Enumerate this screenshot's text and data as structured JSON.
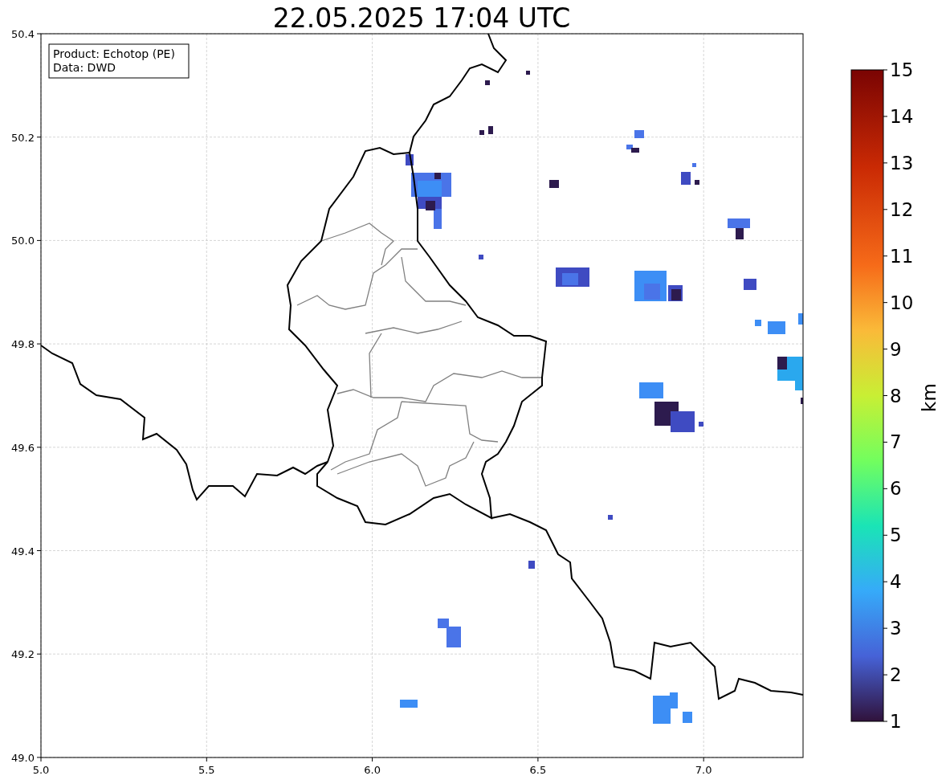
{
  "title": "22.05.2025 17:04 UTC",
  "info_box": [
    "Product: Echotop (PE)",
    "Data: DWD"
  ],
  "x_axis": {
    "ticks": [
      "5.0",
      "5.5",
      "6.0",
      "6.5",
      "7.0"
    ]
  },
  "y_axis": {
    "ticks": [
      "50.4",
      "50.2",
      "50.0",
      "49.8",
      "49.6",
      "49.4",
      "49.2",
      "49.0"
    ]
  },
  "colorbar": {
    "ticks": [
      "15",
      "14",
      "13",
      "12",
      "11",
      "10",
      "9",
      "8",
      "7",
      "6",
      "5",
      "4",
      "3",
      "2",
      "1"
    ],
    "label": "km"
  }
}
